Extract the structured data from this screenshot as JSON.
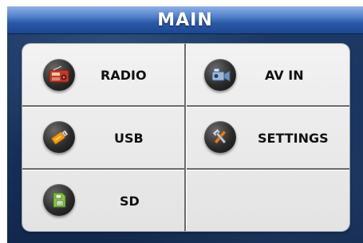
{
  "header": {
    "title": "MAIN"
  },
  "menu": {
    "items": [
      {
        "label": "RADIO",
        "icon": "radio-icon"
      },
      {
        "label": "AV IN",
        "icon": "camcorder-icon"
      },
      {
        "label": "USB",
        "icon": "usb-drive-icon"
      },
      {
        "label": "SETTINGS",
        "icon": "settings-tools-icon"
      },
      {
        "label": "SD",
        "icon": "sd-card-icon"
      }
    ]
  },
  "colors": {
    "background": "#1a3560",
    "title_bar": "#2b5aa8",
    "panel": "#e8e8e8",
    "label_text": "#111111"
  }
}
